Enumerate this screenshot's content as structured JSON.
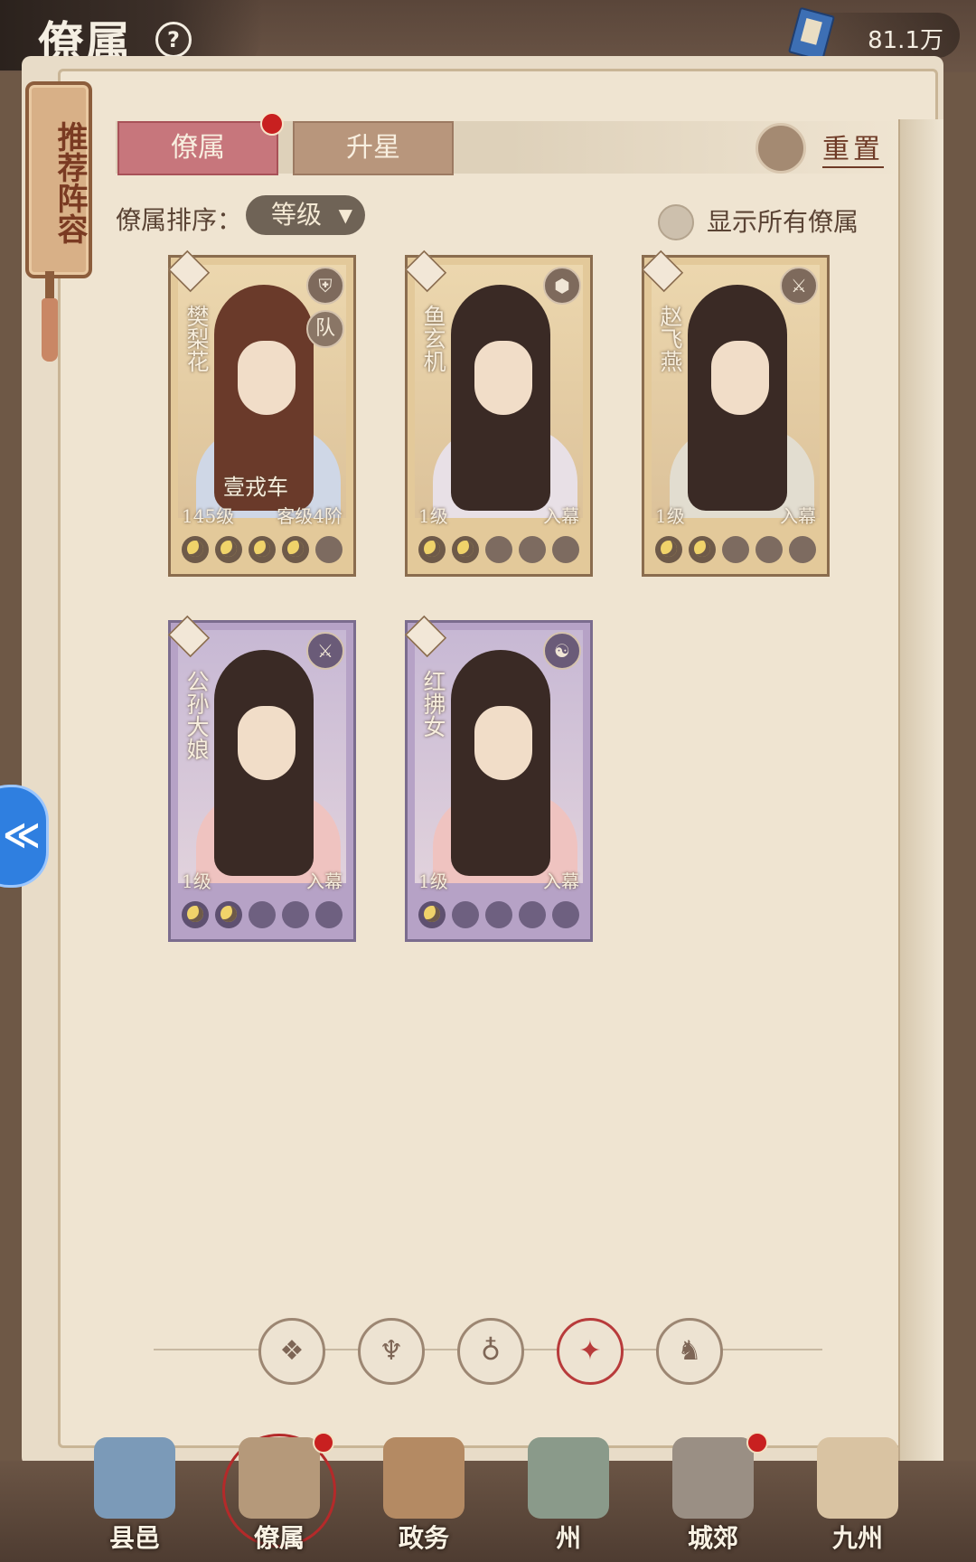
{
  "header": {
    "title": "僚属",
    "help_icon": "question-icon",
    "currency_icon": "book-icon",
    "currency_value": "81.1万"
  },
  "recommend_tag": "推荐阵容",
  "tabs": {
    "active": "僚属",
    "inactive": "升星",
    "reset": "重置"
  },
  "sort": {
    "label": "僚属排序：",
    "value": "等级",
    "arrow": "▼",
    "show_all": "显示所有僚属"
  },
  "cards": [
    {
      "name": "樊梨花",
      "rarity": "gold",
      "class_icon": "shield-icon",
      "team": "队",
      "title_tag": "壹戎车",
      "level": "145级",
      "status": "客级4阶",
      "stars_lit": 4,
      "stars_total": 5
    },
    {
      "name": "鱼玄机",
      "rarity": "gold",
      "class_icon": "turtle-shell-icon",
      "level": "1级",
      "status": "入幕",
      "stars_lit": 2,
      "stars_total": 5
    },
    {
      "name": "赵飞燕",
      "rarity": "gold",
      "class_icon": "crossed-swords-icon",
      "level": "1级",
      "status": "入幕",
      "stars_lit": 2,
      "stars_total": 5
    },
    {
      "name": "公孙大娘",
      "rarity": "purple",
      "class_icon": "crossed-swords-icon",
      "level": "1级",
      "status": "入幕",
      "stars_lit": 2,
      "stars_total": 5
    },
    {
      "name": "红拂女",
      "rarity": "purple",
      "class_icon": "yin-yang-icon",
      "level": "1级",
      "status": "入幕",
      "stars_lit": 1,
      "stars_total": 5
    }
  ],
  "filters": [
    {
      "icon": "diamond-grid-icon",
      "glyph": "❖",
      "active": false
    },
    {
      "icon": "bell-icon",
      "glyph": "♆",
      "active": false
    },
    {
      "icon": "gourd-icon",
      "glyph": "♁",
      "active": false
    },
    {
      "icon": "fan-icon",
      "glyph": "✦",
      "active": true
    },
    {
      "icon": "beast-icon",
      "glyph": "♞",
      "active": false
    }
  ],
  "bottom_nav": [
    {
      "label": "县邑",
      "color": "#7b9ab8",
      "dot": false,
      "active": false
    },
    {
      "label": "僚属",
      "color": "#b5997a",
      "dot": true,
      "active": true
    },
    {
      "label": "政务",
      "color": "#b48a63",
      "dot": false,
      "active": false
    },
    {
      "label": "州",
      "color": "#8a9a8a",
      "dot": false,
      "active": false
    },
    {
      "label": "城郊",
      "color": "#9a8f84",
      "dot": true,
      "active": false
    },
    {
      "label": "九州",
      "color": "#d9c3a2",
      "dot": false,
      "active": false
    }
  ]
}
